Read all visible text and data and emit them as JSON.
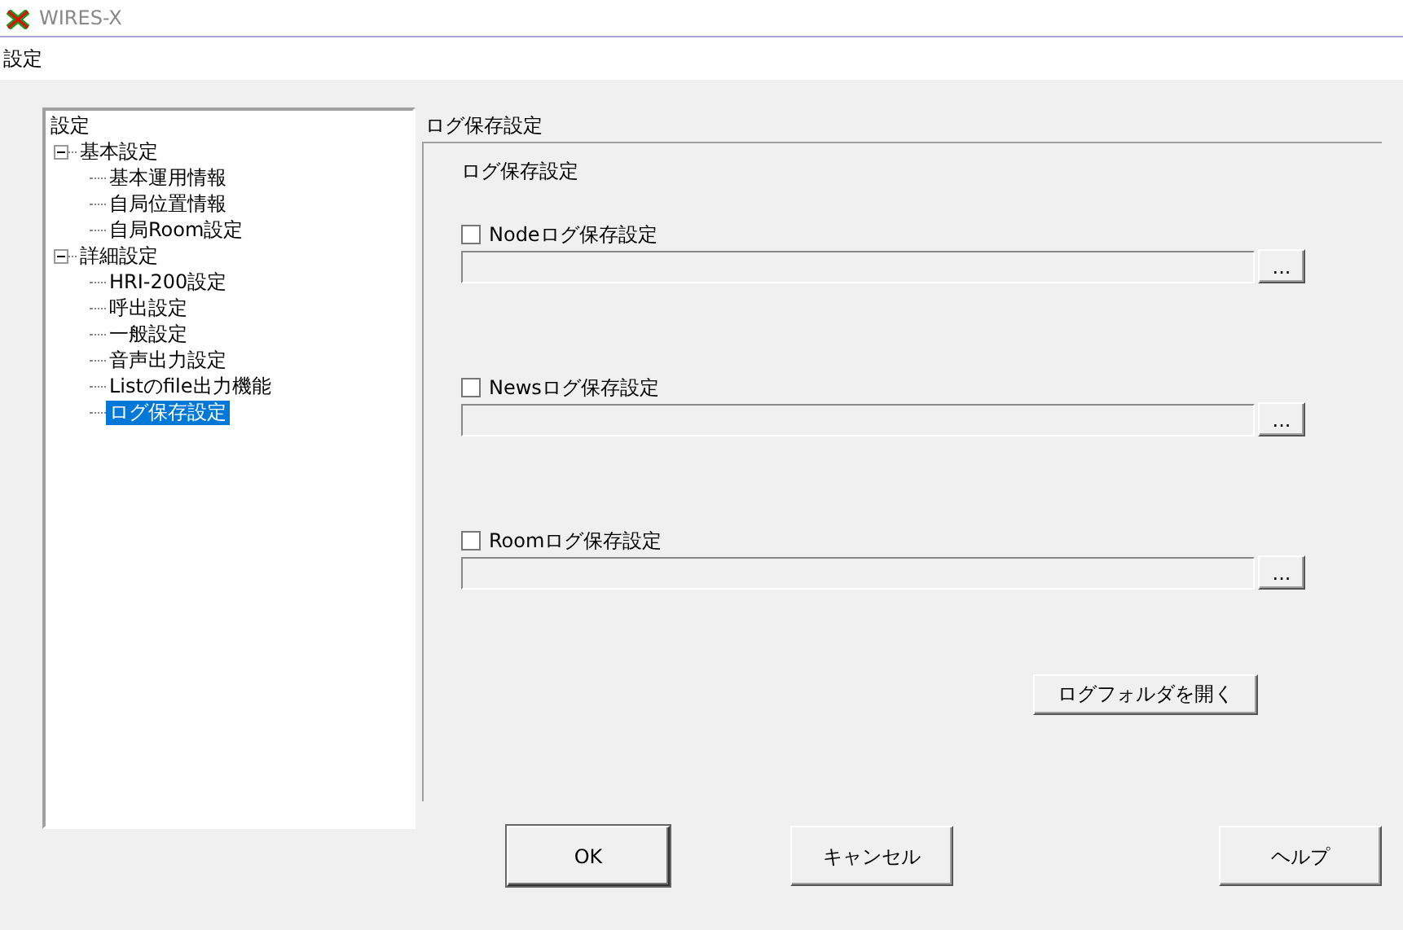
{
  "window": {
    "title": "WIRES-X"
  },
  "header": "設定",
  "tree": {
    "label": "設定",
    "selected": false,
    "children": [
      {
        "label": "基本設定",
        "expanded": true,
        "selected": false,
        "children": [
          {
            "label": "基本運用情報",
            "selected": false
          },
          {
            "label": "自局位置情報",
            "selected": false
          },
          {
            "label": "自局Room設定",
            "selected": false
          }
        ]
      },
      {
        "label": "詳細設定",
        "expanded": true,
        "selected": false,
        "children": [
          {
            "label": "HRI-200設定",
            "selected": false
          },
          {
            "label": "呼出設定",
            "selected": false
          },
          {
            "label": "一般設定",
            "selected": false
          },
          {
            "label": "音声出力設定",
            "selected": false
          },
          {
            "label": "Listのfile出力機能",
            "selected": false
          },
          {
            "label": "ログ保存設定",
            "selected": true
          }
        ]
      }
    ]
  },
  "panel": {
    "title": "ログ保存設定",
    "group_title": "ログ保存設定",
    "logs": [
      {
        "label": "Nodeログ保存設定",
        "checked": false,
        "browse": "..."
      },
      {
        "label": "Newsログ保存設定",
        "checked": false,
        "browse": "..."
      },
      {
        "label": "Roomログ保存設定",
        "checked": false,
        "browse": "..."
      }
    ],
    "open_button": "ログフォルダを開く"
  },
  "buttons": [
    "OK",
    "キャンセル",
    "ヘルプ"
  ]
}
